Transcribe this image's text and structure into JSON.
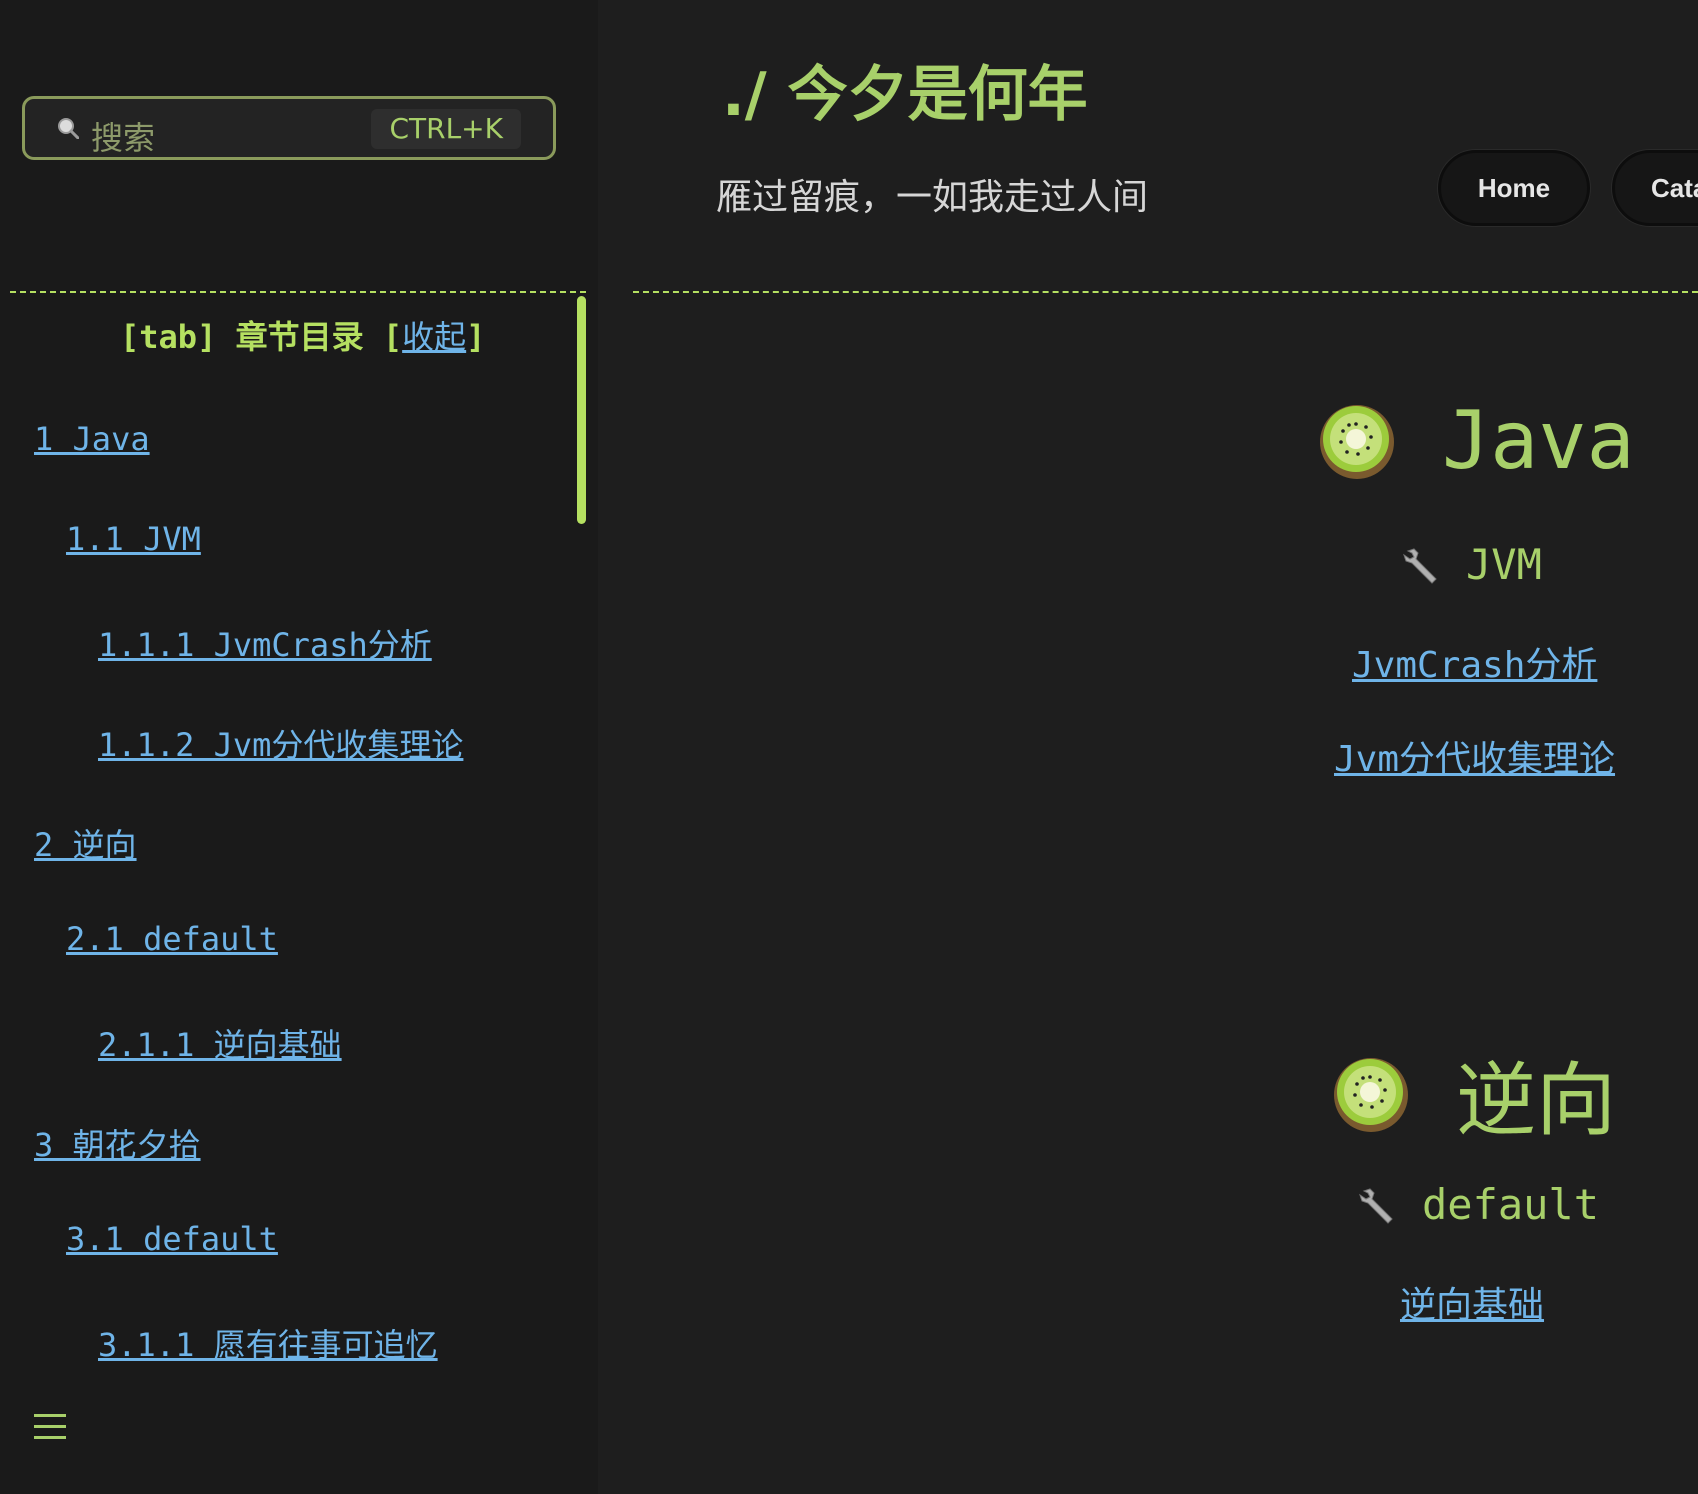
{
  "search": {
    "placeholder": "搜索",
    "shortcut": "CTRL+K"
  },
  "toc": {
    "header_prefix": "[tab] 章节目录 [",
    "collapse_label": "收起",
    "header_suffix": "]",
    "items": [
      {
        "label": "1 Java",
        "level": 1
      },
      {
        "label": "1.1 JVM",
        "level": 2
      },
      {
        "label": "1.1.1 JvmCrash分析",
        "level": 3
      },
      {
        "label": "1.1.2 Jvm分代收集理论",
        "level": 3
      },
      {
        "label": "2 逆向",
        "level": 1
      },
      {
        "label": "2.1 default",
        "level": 2
      },
      {
        "label": "2.1.1 逆向基础",
        "level": 3
      },
      {
        "label": "3 朝花夕拾",
        "level": 1
      },
      {
        "label": "3.1 default",
        "level": 2
      },
      {
        "label": "3.1.1 愿有往事可追忆",
        "level": 3
      }
    ]
  },
  "header": {
    "title": "./ 今夕是何年",
    "subtitle": "雁过留痕，一如我走过人间",
    "nav": [
      {
        "label": "Home"
      },
      {
        "label": "Cata"
      }
    ]
  },
  "main": {
    "sections": [
      {
        "title": "Java",
        "icon": "kiwi-icon",
        "groups": [
          {
            "title": "JVM",
            "icon": "wrench-icon",
            "links": [
              "JvmCrash分析",
              "Jvm分代收集理论"
            ]
          }
        ]
      },
      {
        "title": "逆向",
        "icon": "kiwi-icon",
        "groups": [
          {
            "title": "default",
            "icon": "wrench-icon",
            "links": [
              "逆向基础"
            ]
          }
        ]
      }
    ]
  },
  "colors": {
    "background": "#1e1e1e",
    "accent_green": "#a8d06a",
    "link_blue": "#6fb4e8",
    "divider": "#b5e061"
  }
}
